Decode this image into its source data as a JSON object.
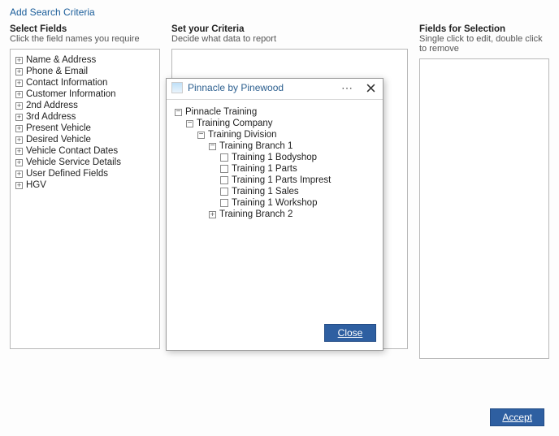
{
  "page_title": "Add Search Criteria",
  "columns": {
    "left": {
      "heading": "Select Fields",
      "sub": "Click the field names you require"
    },
    "mid": {
      "heading": "Set your Criteria",
      "sub": "Decide what data to report"
    },
    "right": {
      "heading": "Fields for Selection",
      "sub": "Single click to edit, double click to remove"
    }
  },
  "field_groups": [
    "Name & Address",
    "Phone & Email",
    "Contact Information",
    "Customer Information",
    "2nd Address",
    "3rd Address",
    "Present Vehicle",
    "Desired Vehicle",
    "Vehicle Contact Dates",
    "Vehicle Service Details",
    "User Defined Fields",
    "HGV"
  ],
  "accept_label": "Accept",
  "dialog": {
    "title": "Pinnacle by Pinewood",
    "close_label": "Close",
    "tree": {
      "root": "Pinnacle Training",
      "company": "Training Company",
      "division": "Training Division",
      "branch1": "Training Branch 1",
      "branch1_items": [
        "Training 1 Bodyshop",
        "Training 1 Parts",
        "Training 1 Parts Imprest",
        "Training 1 Sales",
        "Training 1 Workshop"
      ],
      "branch2": "Training Branch 2"
    }
  }
}
